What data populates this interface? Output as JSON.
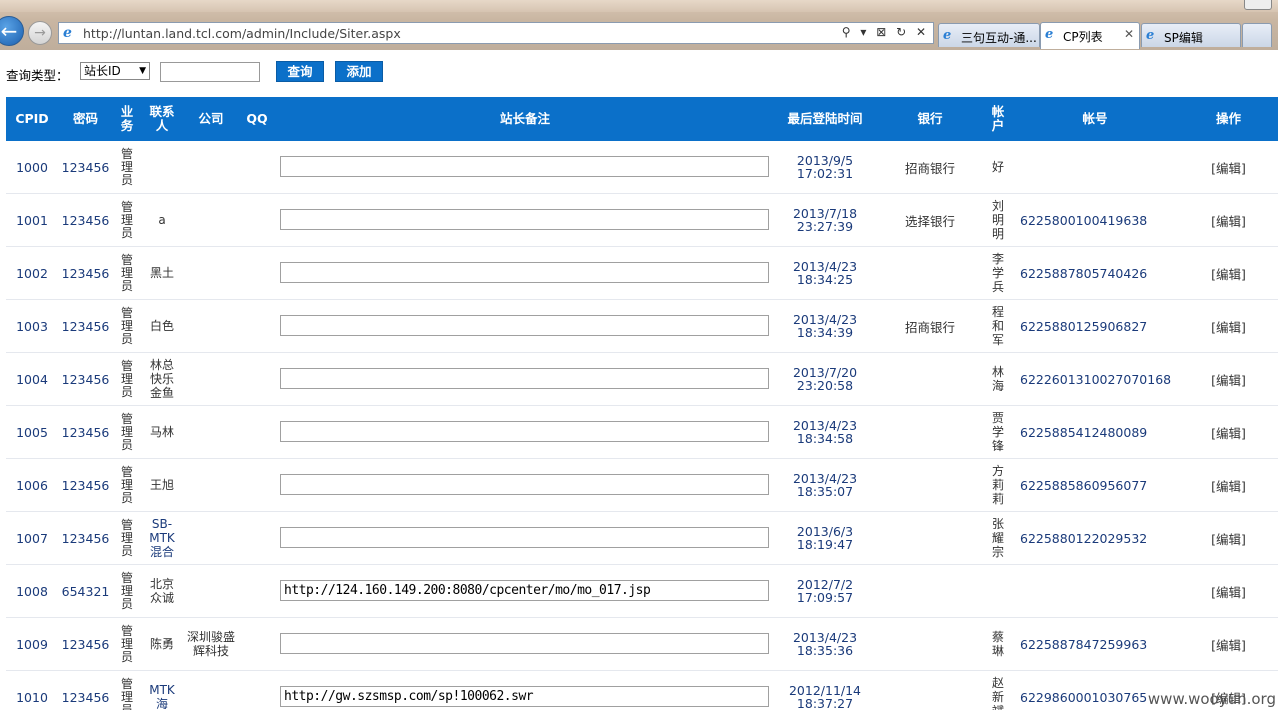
{
  "browser": {
    "url": "http://luntan.land.tcl.com/admin/Include/Siter.aspx",
    "address_tools": "⚲ ▾ ⊠ ↻ ✕",
    "tabs": [
      {
        "label": "三句互动-通..."
      },
      {
        "label": "CP列表"
      },
      {
        "label": "SP编辑"
      }
    ]
  },
  "query": {
    "label": "查询类型：",
    "select_value": "站长ID",
    "search_button": "查询",
    "add_button": "添加"
  },
  "table": {
    "headers": {
      "cpid": "CPID",
      "password": "密码",
      "business": "业务",
      "contact": "联系人",
      "company": "公司",
      "qq": "QQ",
      "remark": "站长备注",
      "last_login": "最后登陆时间",
      "bank": "银行",
      "holder": "帐户",
      "account": "帐号",
      "action": "操作"
    },
    "rows": [
      {
        "cpid": "1000",
        "password": "123456",
        "business": "管理员",
        "contact": "",
        "company": "",
        "qq": "",
        "remark": "",
        "date": "2013/9/5",
        "time": "17:02:31",
        "bank": "招商银行",
        "holder": "好",
        "account": "",
        "action": "[编辑]"
      },
      {
        "cpid": "1001",
        "password": "123456",
        "business": "管理员",
        "contact": "a",
        "company": "",
        "qq": "",
        "remark": "",
        "date": "2013/7/18",
        "time": "23:27:39",
        "bank": "选择银行",
        "holder": "刘明明",
        "account": "6225800100419638",
        "action": "[编辑]"
      },
      {
        "cpid": "1002",
        "password": "123456",
        "business": "管理员",
        "contact": "黑土",
        "company": "",
        "qq": "",
        "remark": "",
        "date": "2013/4/23",
        "time": "18:34:25",
        "bank": "",
        "holder": "李学兵",
        "account": "6225887805740426",
        "action": "[编辑]"
      },
      {
        "cpid": "1003",
        "password": "123456",
        "business": "管理员",
        "contact": "白色",
        "company": "",
        "qq": "",
        "remark": "",
        "date": "2013/4/23",
        "time": "18:34:39",
        "bank": "招商银行",
        "holder": "程和军",
        "account": "6225880125906827",
        "action": "[编辑]"
      },
      {
        "cpid": "1004",
        "password": "123456",
        "business": "管理员",
        "contact": "林总快乐金鱼",
        "company": "",
        "qq": "",
        "remark": "",
        "date": "2013/7/20",
        "time": "23:20:58",
        "bank": "",
        "holder": "林海",
        "account": "6222601310027070168",
        "action": "[编辑]"
      },
      {
        "cpid": "1005",
        "password": "123456",
        "business": "管理员",
        "contact": "马林",
        "company": "",
        "qq": "",
        "remark": "",
        "date": "2013/4/23",
        "time": "18:34:58",
        "bank": "",
        "holder": "贾学锋",
        "account": "6225885412480089",
        "action": "[编辑]"
      },
      {
        "cpid": "1006",
        "password": "123456",
        "business": "管理员",
        "contact": "王旭",
        "company": "",
        "qq": "",
        "remark": "",
        "date": "2013/4/23",
        "time": "18:35:07",
        "bank": "",
        "holder": "方莉莉",
        "account": "6225885860956077",
        "action": "[编辑]"
      },
      {
        "cpid": "1007",
        "password": "123456",
        "business": "管理员",
        "contact": "SB-MTK混合",
        "company": "",
        "qq": "",
        "remark": "",
        "date": "2013/6/3",
        "time": "18:19:47",
        "bank": "",
        "holder": "张耀宗",
        "account": "6225880122029532",
        "action": "[编辑]"
      },
      {
        "cpid": "1008",
        "password": "654321",
        "business": "管理员",
        "contact": "北京众诚",
        "company": "",
        "qq": "",
        "remark": "http://124.160.149.200:8080/cpcenter/mo/mo_017.jsp",
        "date": "2012/7/2",
        "time": "17:09:57",
        "bank": "",
        "holder": "",
        "account": "",
        "action": "[编辑]"
      },
      {
        "cpid": "1009",
        "password": "123456",
        "business": "管理员",
        "contact": "陈勇",
        "company": "深圳骏盛辉科技",
        "qq": "",
        "remark": "",
        "date": "2013/4/23",
        "time": "18:35:36",
        "bank": "",
        "holder": "蔡琳",
        "account": "6225887847259963",
        "action": "[编辑]"
      },
      {
        "cpid": "1010",
        "password": "123456",
        "business": "管理员",
        "contact": "MTK海",
        "company": "",
        "qq": "",
        "remark": "http://gw.szsmsp.com/sp!100062.swr",
        "date": "2012/11/14",
        "time": "18:37:27",
        "bank": "",
        "holder": "赵新斌",
        "account": "6229860001030765",
        "action": "[编辑]"
      }
    ]
  },
  "watermark": "www.wooyun.org"
}
